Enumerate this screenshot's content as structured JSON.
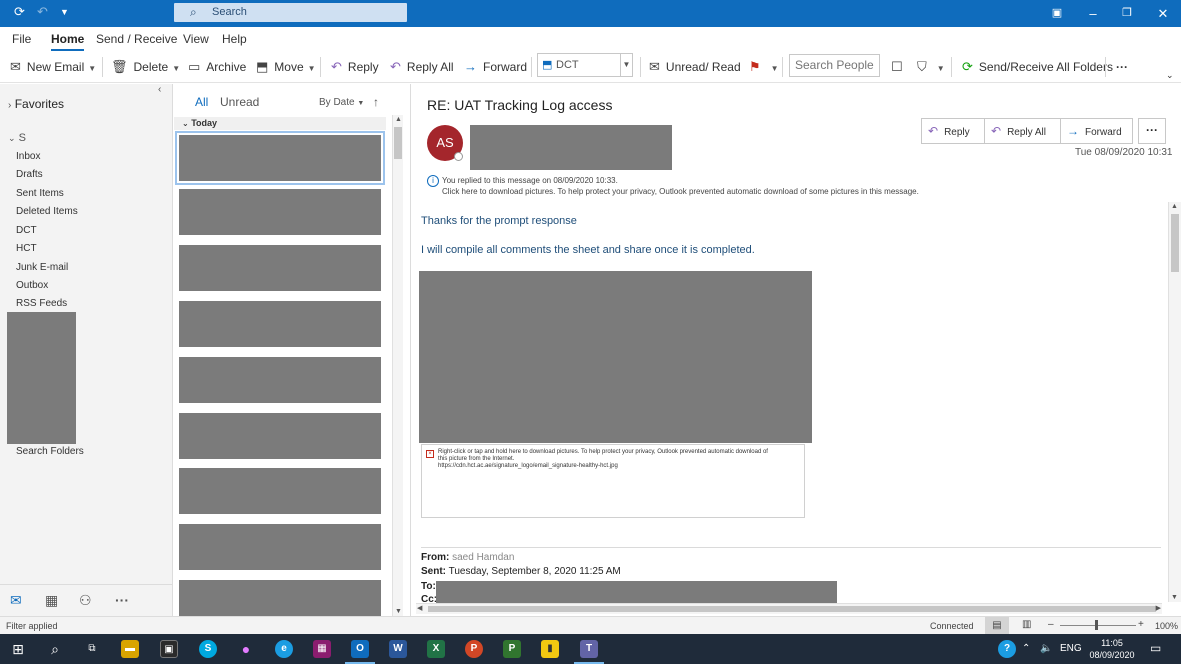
{
  "titlebar": {
    "search_placeholder": "Search",
    "search_icon": "search-icon",
    "sync_icon": "refresh-icon",
    "undo_icon": "undo-icon",
    "customize_icon": "dropdown-icon"
  },
  "menu": {
    "items": [
      "File",
      "Home",
      "Send / Receive",
      "View",
      "Help"
    ],
    "active": "Home"
  },
  "ribbon": {
    "new_email": "New Email",
    "delete": "Delete",
    "archive": "Archive",
    "move": "Move",
    "reply": "Reply",
    "reply_all": "Reply All",
    "forward": "Forward",
    "folder": "DCT",
    "unread_read": "Unread/ Read",
    "search_people": "Search People",
    "send_receive_all": "Send/Receive All Folders",
    "more": "···"
  },
  "folderpane": {
    "favorites": "Favorites",
    "account": "S",
    "folders": [
      "Inbox",
      "Drafts",
      "Sent Items",
      "Deleted Items",
      "DCT",
      "HCT",
      "Junk E-mail",
      "Outbox",
      "RSS Feeds"
    ],
    "search_folders": "Search Folders"
  },
  "msglist": {
    "tab_all": "All",
    "tab_unread": "Unread",
    "sort": "By Date",
    "group": "Today"
  },
  "reading": {
    "subject": "RE: UAT Tracking Log access",
    "avatar_initials": "AS",
    "reply": "Reply",
    "reply_all": "Reply All",
    "forward": "Forward",
    "date": "Tue 08/09/2020 10:31",
    "info_line1": "You replied to this message on 08/09/2020 10:33.",
    "info_line2": "Click here to download pictures. To help protect your privacy, Outlook prevented automatic download of some pictures in this message.",
    "body_line1": "Thanks for the prompt response",
    "body_line2": "I will compile all comments the sheet and share once it is completed.",
    "img_text1": "Right-click or tap and hold here to download pictures. To help protect your privacy, Outlook prevented automatic download of",
    "img_text2": "this picture from the Internet.",
    "img_text3": "https://cdn.hct.ac.ae/signature_logo/email_signature-healthy-hct.jpg",
    "from_label": "From:",
    "from_value": "saed Hamdan",
    "sent_label": "Sent:",
    "sent_value": "Tuesday, September 8, 2020 11:25 AM",
    "to_label": "To:",
    "cc_label": "Cc:"
  },
  "statusbar": {
    "filter": "Filter applied",
    "connected": "Connected",
    "zoom": "100%"
  },
  "taskbar": {
    "lang": "ENG",
    "time": "11:05",
    "date": "08/09/2020"
  }
}
